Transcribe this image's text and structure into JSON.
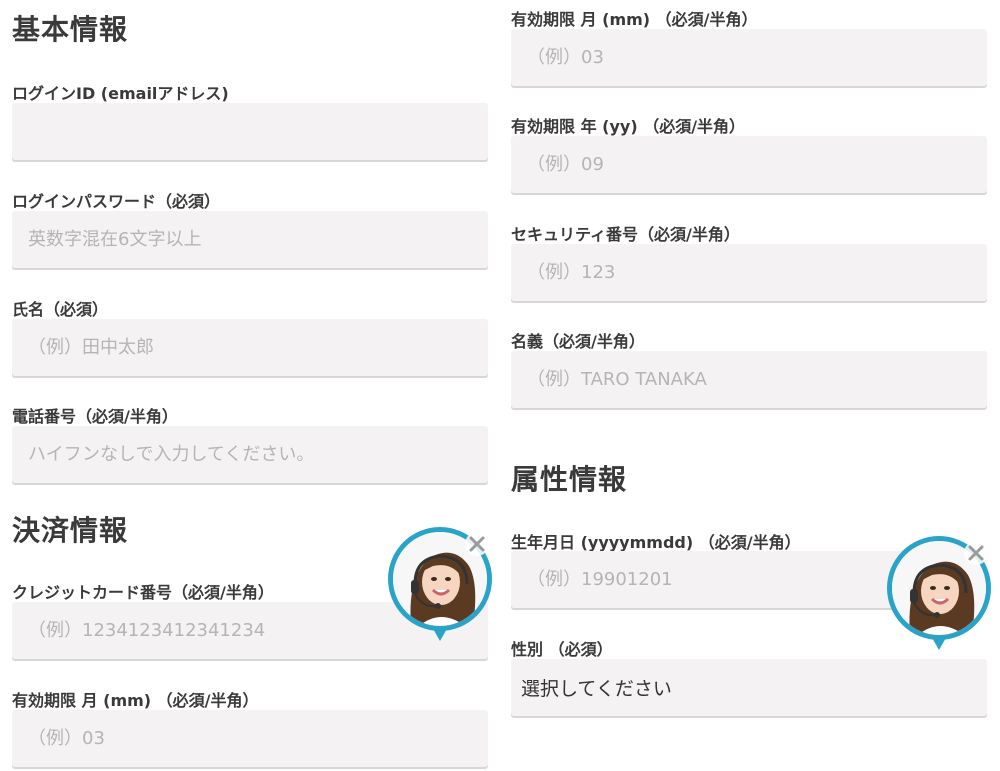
{
  "left": {
    "basic_title": "基本情報",
    "login_id_label": "ログインID (emailアドレス)",
    "login_id_value": "",
    "password_label": "ログインパスワード（必須）",
    "password_placeholder": "英数字混在6文字以上",
    "name_label": "氏名（必須）",
    "name_placeholder": "（例）田中太郎",
    "phone_label": "電話番号（必須/半角）",
    "phone_placeholder": "ハイフンなしで入力してください。",
    "payment_title": "決済情報",
    "card_label": "クレジットカード番号（必須/半角）",
    "card_placeholder": "（例）1234123412341234",
    "exp_month_label": "有効期限 月 (mm) （必須/半角）",
    "exp_month_placeholder": "（例）03"
  },
  "right": {
    "exp_month_label": "有効期限 月 (mm) （必須/半角）",
    "exp_month_placeholder": "（例）03",
    "exp_year_label": "有効期限 年 (yy) （必須/半角）",
    "exp_year_placeholder": "（例）09",
    "security_label": "セキュリティ番号（必須/半角）",
    "security_placeholder": "（例）123",
    "holder_label": "名義（必須/半角）",
    "holder_placeholder": "（例）TARO TANAKA",
    "attr_title": "属性情報",
    "birth_label": "生年月日 (yyyymmdd) （必須/半角）",
    "birth_placeholder": "（例）19901201",
    "gender_label": "性別 （必須）",
    "gender_value": "選択してください"
  },
  "colors": {
    "accent": "#2aa3c8",
    "field_bg": "#f4f2f2",
    "placeholder": "#b5b5b5"
  },
  "icons": [
    "support-avatar-icon",
    "close-icon"
  ]
}
